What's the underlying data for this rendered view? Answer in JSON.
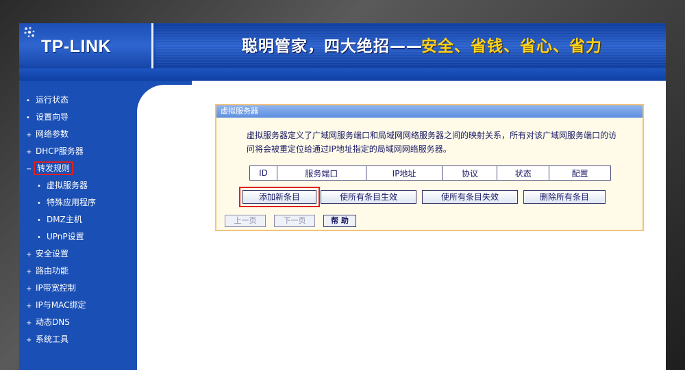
{
  "brand": {
    "logo_text": "TP-LINK",
    "slogan_main": "聪明管家，四大绝招——",
    "slogan_accent": "安全、省钱、省心、省力",
    "accent_color": "#ffd21a"
  },
  "sidebar": {
    "items": [
      {
        "label": "运行状态",
        "bullet": "•"
      },
      {
        "label": "设置向导",
        "bullet": "•"
      },
      {
        "label": "网络参数",
        "bullet": "+"
      },
      {
        "label": "DHCP服务器",
        "bullet": "+"
      },
      {
        "label": "转发规则",
        "bullet": "−",
        "active": true
      },
      {
        "label": "虚拟服务器",
        "bullet": "•",
        "sub": true
      },
      {
        "label": "特殊应用程序",
        "bullet": "•",
        "sub": true
      },
      {
        "label": "DMZ主机",
        "bullet": "•",
        "sub": true
      },
      {
        "label": "UPnP设置",
        "bullet": "•",
        "sub": true
      },
      {
        "label": "安全设置",
        "bullet": "+"
      },
      {
        "label": "路由功能",
        "bullet": "+"
      },
      {
        "label": "IP带宽控制",
        "bullet": "+"
      },
      {
        "label": "IP与MAC绑定",
        "bullet": "+"
      },
      {
        "label": "动态DNS",
        "bullet": "+"
      },
      {
        "label": "系统工具",
        "bullet": "+"
      }
    ]
  },
  "panel": {
    "title": "虚拟服务器",
    "description": "虚拟服务器定义了广域网服务端口和局域网网络服务器之间的映射关系，所有对该广域网服务端口的访问将会被重定位给通过IP地址指定的局域网网络服务器。",
    "table_headers": [
      "ID",
      "服务端口",
      "IP地址",
      "协议",
      "状态",
      "配置"
    ],
    "buttons": {
      "add": "添加新条目",
      "enable_all": "使所有条目生效",
      "disable_all": "使所有条目失效",
      "delete_all": "删除所有条目"
    },
    "pager": {
      "prev": "上一页",
      "next": "下一页",
      "help": "帮 助"
    }
  },
  "highlight_color": "#e02020"
}
